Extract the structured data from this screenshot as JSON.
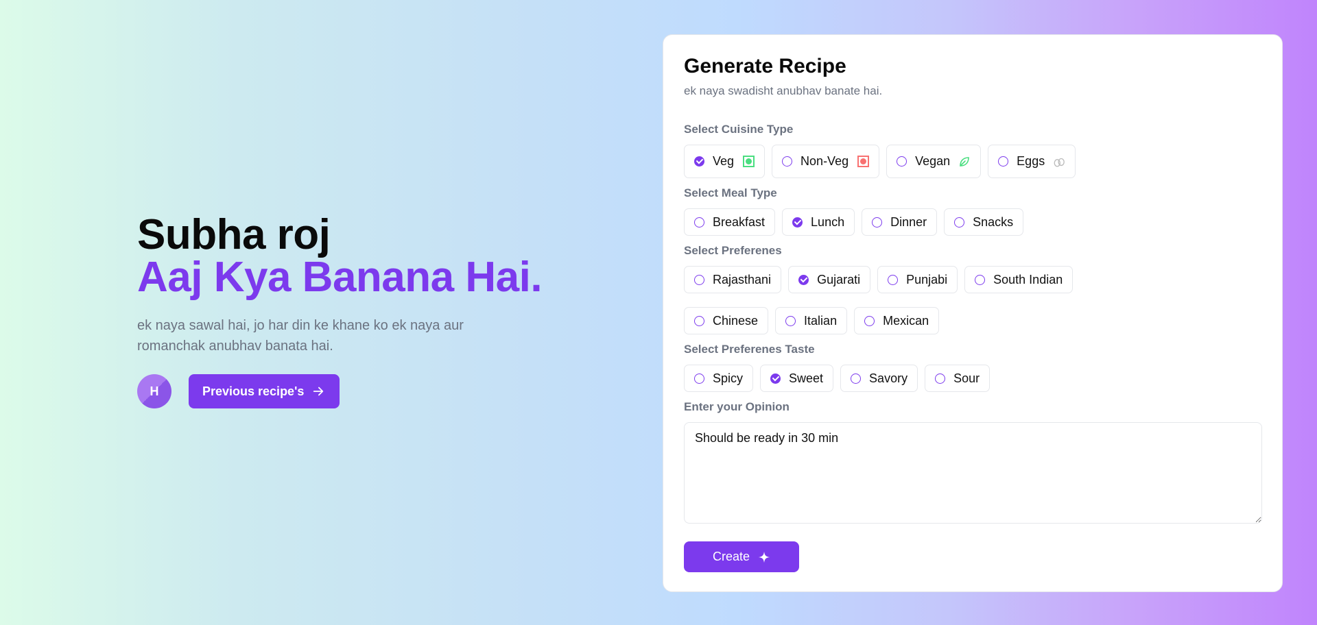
{
  "hero": {
    "title_line1": "Subha roj",
    "title_line2": "Aaj Kya Banana Hai.",
    "description": "ek naya sawal hai, jo har din ke khane ko ek naya aur romanchak anubhav banata hai.",
    "avatar_initial": "H",
    "previous_button": "Previous recipe's"
  },
  "form": {
    "title": "Generate Recipe",
    "subtitle": "ek naya swadisht anubhav banate hai.",
    "cuisine": {
      "label": "Select Cuisine Type",
      "options": [
        {
          "label": "Veg",
          "selected": true,
          "icon": "veg-mark-icon"
        },
        {
          "label": "Non-Veg",
          "selected": false,
          "icon": "non-veg-mark-icon"
        },
        {
          "label": "Vegan",
          "selected": false,
          "icon": "leaf-icon"
        },
        {
          "label": "Eggs",
          "selected": false,
          "icon": "eggs-icon"
        }
      ]
    },
    "meal": {
      "label": "Select Meal Type",
      "options": [
        {
          "label": "Breakfast",
          "selected": false
        },
        {
          "label": "Lunch",
          "selected": true
        },
        {
          "label": "Dinner",
          "selected": false
        },
        {
          "label": "Snacks",
          "selected": false
        }
      ]
    },
    "preferences": {
      "label": "Select Preferenes",
      "options": [
        {
          "label": "Rajasthani",
          "selected": false
        },
        {
          "label": "Gujarati",
          "selected": true
        },
        {
          "label": "Punjabi",
          "selected": false
        },
        {
          "label": "South Indian",
          "selected": false
        },
        {
          "label": "Chinese",
          "selected": false
        },
        {
          "label": "Italian",
          "selected": false
        },
        {
          "label": "Mexican",
          "selected": false
        }
      ]
    },
    "taste": {
      "label": "Select Preferenes Taste",
      "options": [
        {
          "label": "Spicy",
          "selected": false
        },
        {
          "label": "Sweet",
          "selected": true
        },
        {
          "label": "Savory",
          "selected": false
        },
        {
          "label": "Sour",
          "selected": false
        }
      ]
    },
    "opinion": {
      "label": "Enter your Opinion",
      "value": "Should be ready in 30 min"
    },
    "create_button": "Create"
  },
  "colors": {
    "accent": "#7c3aed",
    "veg": "#4ade80",
    "non_veg": "#f87171"
  }
}
